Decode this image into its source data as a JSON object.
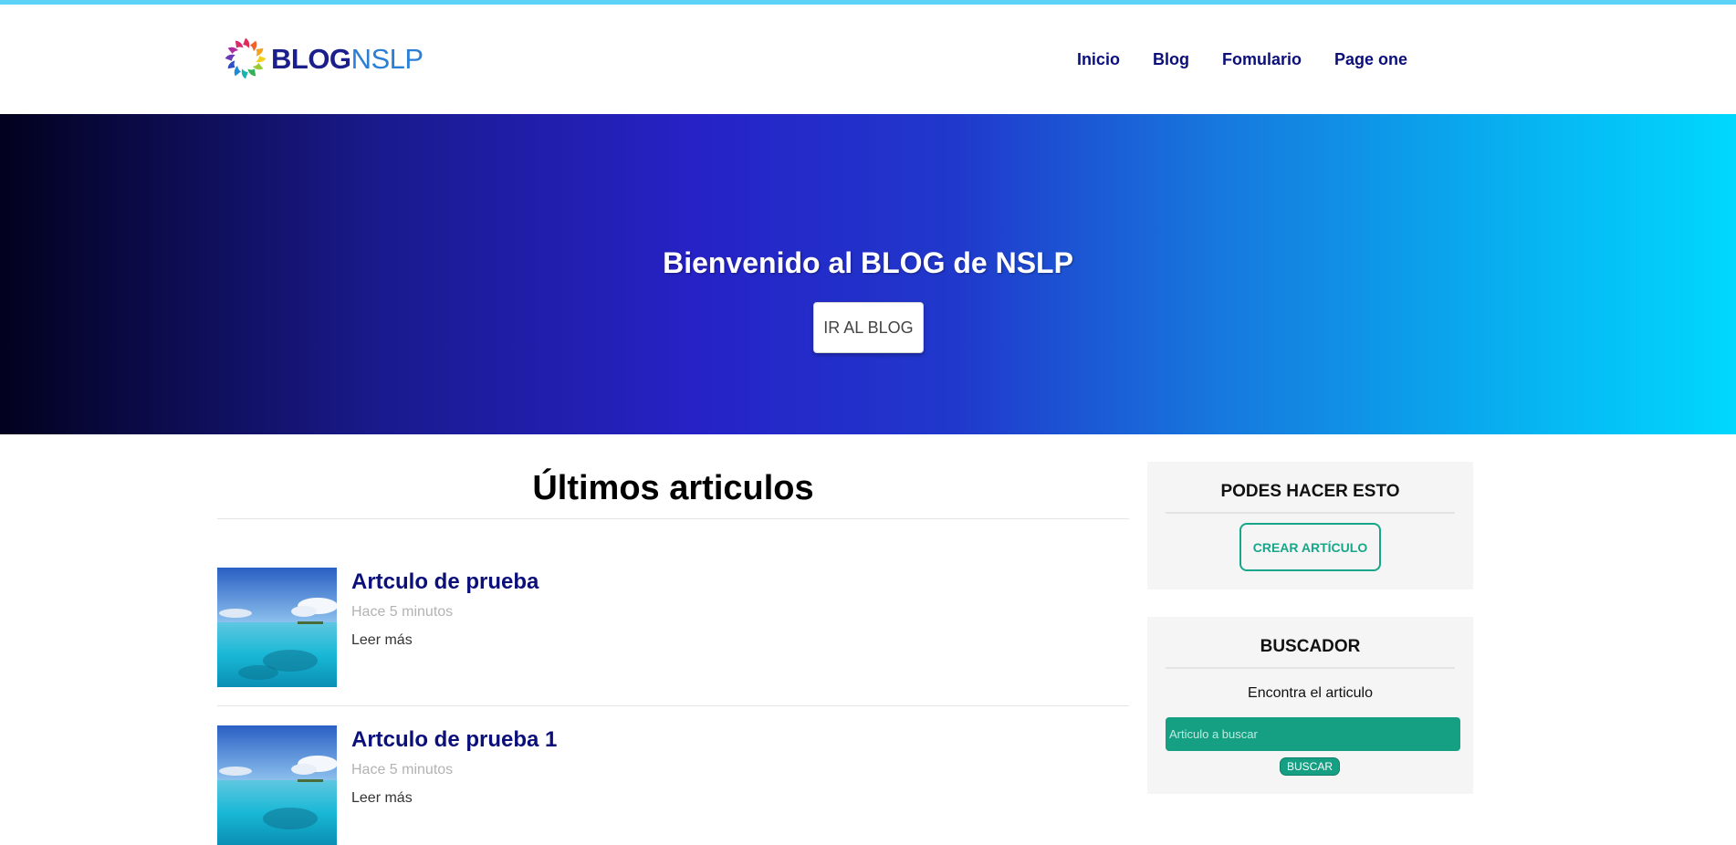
{
  "brand": {
    "logo_bold": "BLOG",
    "logo_light": "NSLP"
  },
  "nav": {
    "items": [
      {
        "label": "Inicio"
      },
      {
        "label": "Blog"
      },
      {
        "label": "Fomulario"
      },
      {
        "label": "Page one"
      }
    ]
  },
  "hero": {
    "title": "Bienvenido al BLOG de NSLP",
    "button_label": "IR AL BLOG"
  },
  "main": {
    "section_title": "Últimos articulos",
    "articles": [
      {
        "title": "Artculo de prueba",
        "time": "Hace 5 minutos",
        "more": "Leer más"
      },
      {
        "title": "Artculo de prueba 1",
        "time": "Hace 5 minutos",
        "more": "Leer más"
      }
    ]
  },
  "sidebar": {
    "actions": {
      "title": "PODES HACER ESTO",
      "create_label": "CREAR ARTÍCULO"
    },
    "search": {
      "title": "BUSCADOR",
      "label": "Encontra el articulo",
      "placeholder": "Articulo a buscar",
      "button_label": "BUSCAR"
    }
  },
  "colors": {
    "accent": "#17a689",
    "nav_text": "#0b0f7a",
    "top_strip": "#5cd3f6"
  }
}
